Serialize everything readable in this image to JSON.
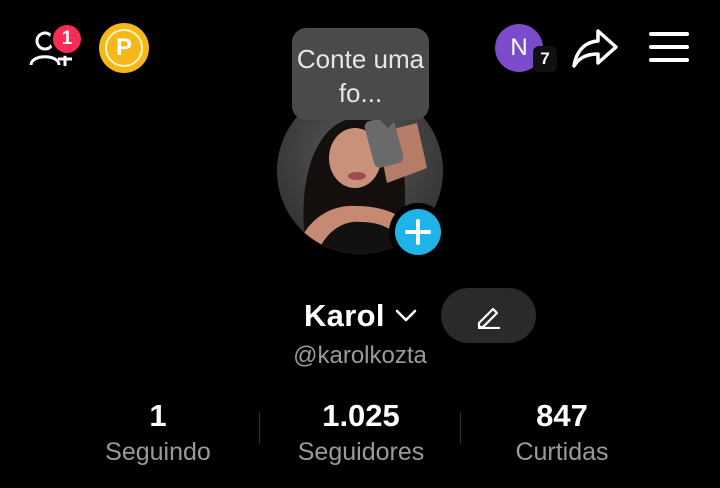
{
  "header": {
    "notifications_count": "1",
    "coins_label": "P",
    "account_initial": "N",
    "account_count": "7"
  },
  "tooltip": {
    "text": "Conte uma fo..."
  },
  "profile": {
    "display_name": "Karol",
    "username": "@karolkozta"
  },
  "stats": [
    {
      "value": "1",
      "label": "Seguindo"
    },
    {
      "value": "1.025",
      "label": "Seguidores"
    },
    {
      "value": "847",
      "label": "Curtidas"
    }
  ],
  "colors": {
    "background": "#000000",
    "badge": "#fe2c55",
    "coin": "#f6b819",
    "account_avatar": "#7b4cc9",
    "add_story": "#20b3e8"
  },
  "icons": [
    "add-friend-icon",
    "coin-icon",
    "share-icon",
    "menu-icon",
    "chevron-down-icon",
    "edit-pencil-icon",
    "plus-icon"
  ]
}
